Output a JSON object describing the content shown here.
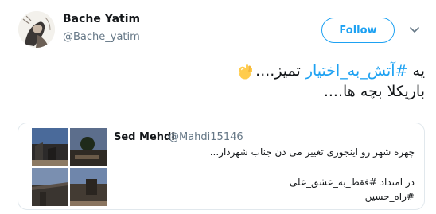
{
  "author": {
    "name": "Bache Yatim",
    "handle": "@Bache_yatim"
  },
  "follow_button": {
    "label": "Follow"
  },
  "tweet": {
    "line1_prefix": "یه ",
    "hashtag": "#آتش_به_اختیار",
    "line1_suffix": " تمیز....",
    "line2": "باریکلا بچه ها....",
    "emoji_icon": "ok-hand-icon"
  },
  "quoted_tweet": {
    "name": "Sed Mehdi",
    "handle": "@Mahdi15146",
    "text_line1": "چهره شهر رو اینجوری تغییر می دن جناب شهردار...",
    "text_line2": "در امتداد #فقط_به_عشق_علی",
    "text_line3": "#راه_حسین"
  },
  "colors": {
    "accent": "#1da1f2",
    "secondary_text": "#657786",
    "border": "#e1e8ed"
  }
}
